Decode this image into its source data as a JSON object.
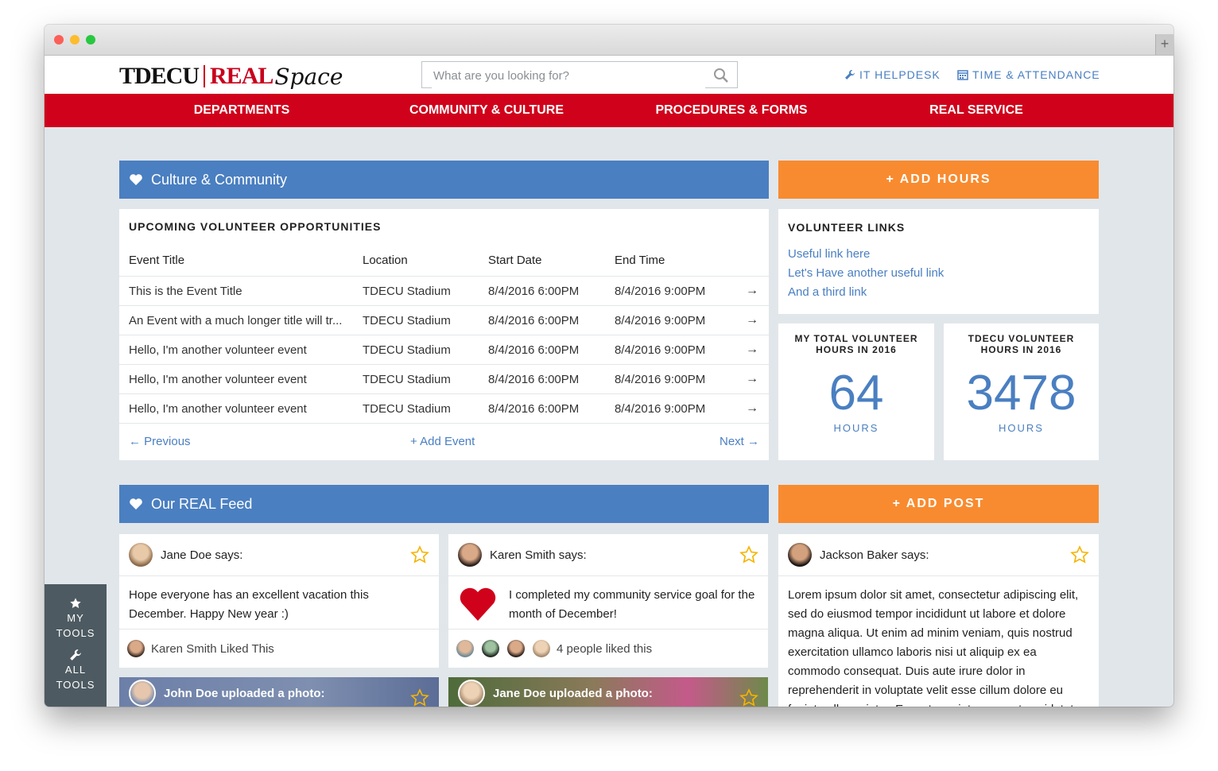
{
  "header": {
    "search_placeholder": "What are you looking for?",
    "links": [
      "IT HELPDESK",
      "TIME & ATTENDANCE"
    ]
  },
  "nav": [
    "DEPARTMENTS",
    "COMMUNITY & CULTURE",
    "PROCEDURES & FORMS",
    "REAL SERVICE"
  ],
  "culture": {
    "title": "Culture & Community",
    "add_hours": "+ ADD HOURS",
    "opportunities_heading": "UPCOMING VOLUNTEER OPPORTUNITIES",
    "columns": [
      "Event Title",
      "Location",
      "Start Date",
      "End Time"
    ],
    "rows": [
      [
        "This is the Event Title",
        "TDECU Stadium",
        "8/4/2016 6:00PM",
        "8/4/2016 9:00PM"
      ],
      [
        "An Event with a much longer title will tr...",
        "TDECU Stadium",
        "8/4/2016 6:00PM",
        "8/4/2016 9:00PM"
      ],
      [
        "Hello, I'm another volunteer event",
        "TDECU Stadium",
        "8/4/2016 6:00PM",
        "8/4/2016 9:00PM"
      ],
      [
        "Hello, I'm another volunteer event",
        "TDECU Stadium",
        "8/4/2016 6:00PM",
        "8/4/2016 9:00PM"
      ],
      [
        "Hello, I'm another volunteer event",
        "TDECU Stadium",
        "8/4/2016 6:00PM",
        "8/4/2016 9:00PM"
      ]
    ],
    "previous": "Previous",
    "add_event": "+ Add Event",
    "next": "Next",
    "links_heading": "VOLUNTEER LINKS",
    "links": [
      "Useful link here",
      "Let's Have another useful link",
      "And a third link"
    ],
    "my_hours": {
      "label1": "MY TOTAL VOLUNTEER",
      "label2": "HOURS IN 2016",
      "value": "64",
      "unit": "HOURS"
    },
    "tdecu_hours": {
      "label1": "TDECU VOLUNTEER",
      "label2": "HOURS IN 2016",
      "value": "3478",
      "unit": "HOURS"
    }
  },
  "feed": {
    "title": "Our REAL Feed",
    "add_post": "+ ADD POST",
    "posts": [
      {
        "author": "Jane Doe says:",
        "text": "Hope everyone has an excellent vacation this December. Happy New year :)",
        "footer": "Karen Smith Liked This"
      },
      {
        "author": "Karen Smith says:",
        "text": "I completed my community service goal for the month of December!",
        "footer": "4 people liked this"
      },
      {
        "author": "Jackson Baker says:",
        "text": "Lorem ipsum dolor sit amet, consectetur adipiscing elit, sed do eiusmod tempor incididunt ut labore et dolore magna aliqua. Ut enim ad minim veniam, quis nostrud exercitation ullamco laboris nisi ut aliquip ex ea commodo consequat. Duis aute irure dolor in reprehenderit in voluptate velit esse cillum dolore eu fugiat nulla pariatur. Excepteur sint occaecat cupidatat"
      }
    ],
    "photos": [
      "John Doe uploaded a photo:",
      "Jane Doe uploaded a photo:"
    ]
  },
  "tools": {
    "my": [
      "MY",
      "TOOLS"
    ],
    "all": [
      "ALL",
      "TOOLS"
    ]
  },
  "colors": {
    "brand_red": "#d0021b",
    "accent_blue": "#4a7fc1",
    "orange": "#f88b2f",
    "background": "#e1e6ea"
  }
}
